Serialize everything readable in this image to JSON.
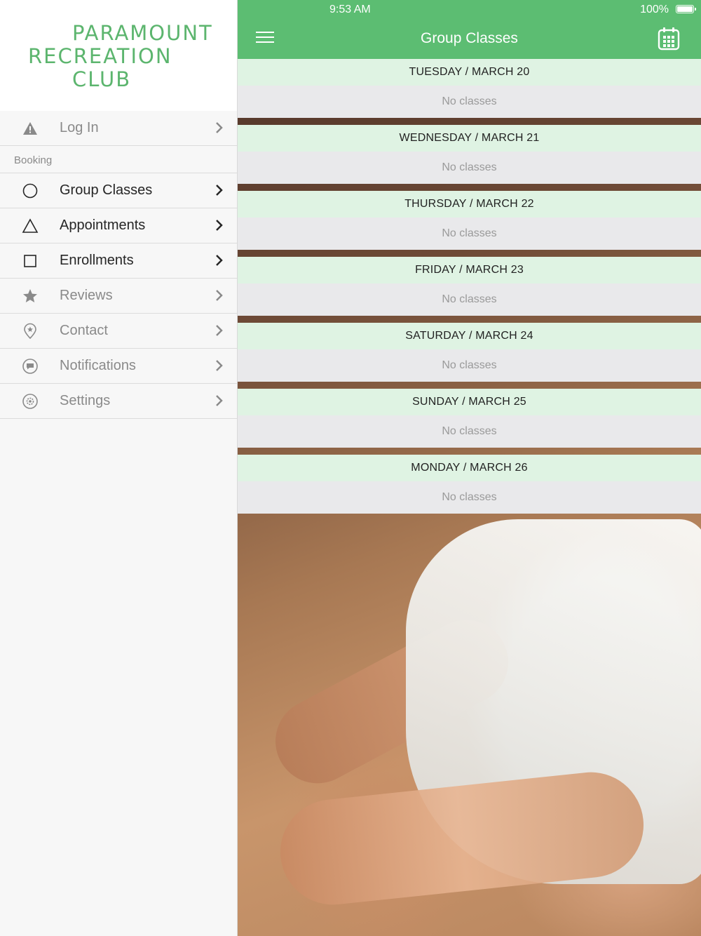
{
  "brand": {
    "line1": "PARAMOUNT",
    "line2": "RECREATION",
    "line3": "CLUB",
    "color": "#5cb56e"
  },
  "sidebar": {
    "login": {
      "label": "Log In",
      "icon": "warning-icon"
    },
    "section_label": "Booking",
    "items": [
      {
        "label": "Group Classes",
        "icon": "circle-icon"
      },
      {
        "label": "Appointments",
        "icon": "triangle-icon"
      },
      {
        "label": "Enrollments",
        "icon": "square-icon"
      },
      {
        "label": "Reviews",
        "icon": "star-icon"
      },
      {
        "label": "Contact",
        "icon": "location-pin-icon"
      },
      {
        "label": "Notifications",
        "icon": "chat-bubble-icon"
      },
      {
        "label": "Settings",
        "icon": "gear-icon"
      }
    ]
  },
  "status_bar": {
    "time": "9:53 AM",
    "battery": "100%"
  },
  "nav": {
    "title": "Group Classes",
    "accent": "#5cbd72"
  },
  "days": [
    {
      "header": "TUESDAY / MARCH 20",
      "status": "No classes"
    },
    {
      "header": "WEDNESDAY / MARCH 21",
      "status": "No classes"
    },
    {
      "header": "THURSDAY / MARCH 22",
      "status": "No classes"
    },
    {
      "header": "FRIDAY / MARCH 23",
      "status": "No classes"
    },
    {
      "header": "SATURDAY / MARCH 24",
      "status": "No classes"
    },
    {
      "header": "SUNDAY / MARCH 25",
      "status": "No classes"
    },
    {
      "header": "MONDAY / MARCH 26",
      "status": "No classes"
    }
  ]
}
